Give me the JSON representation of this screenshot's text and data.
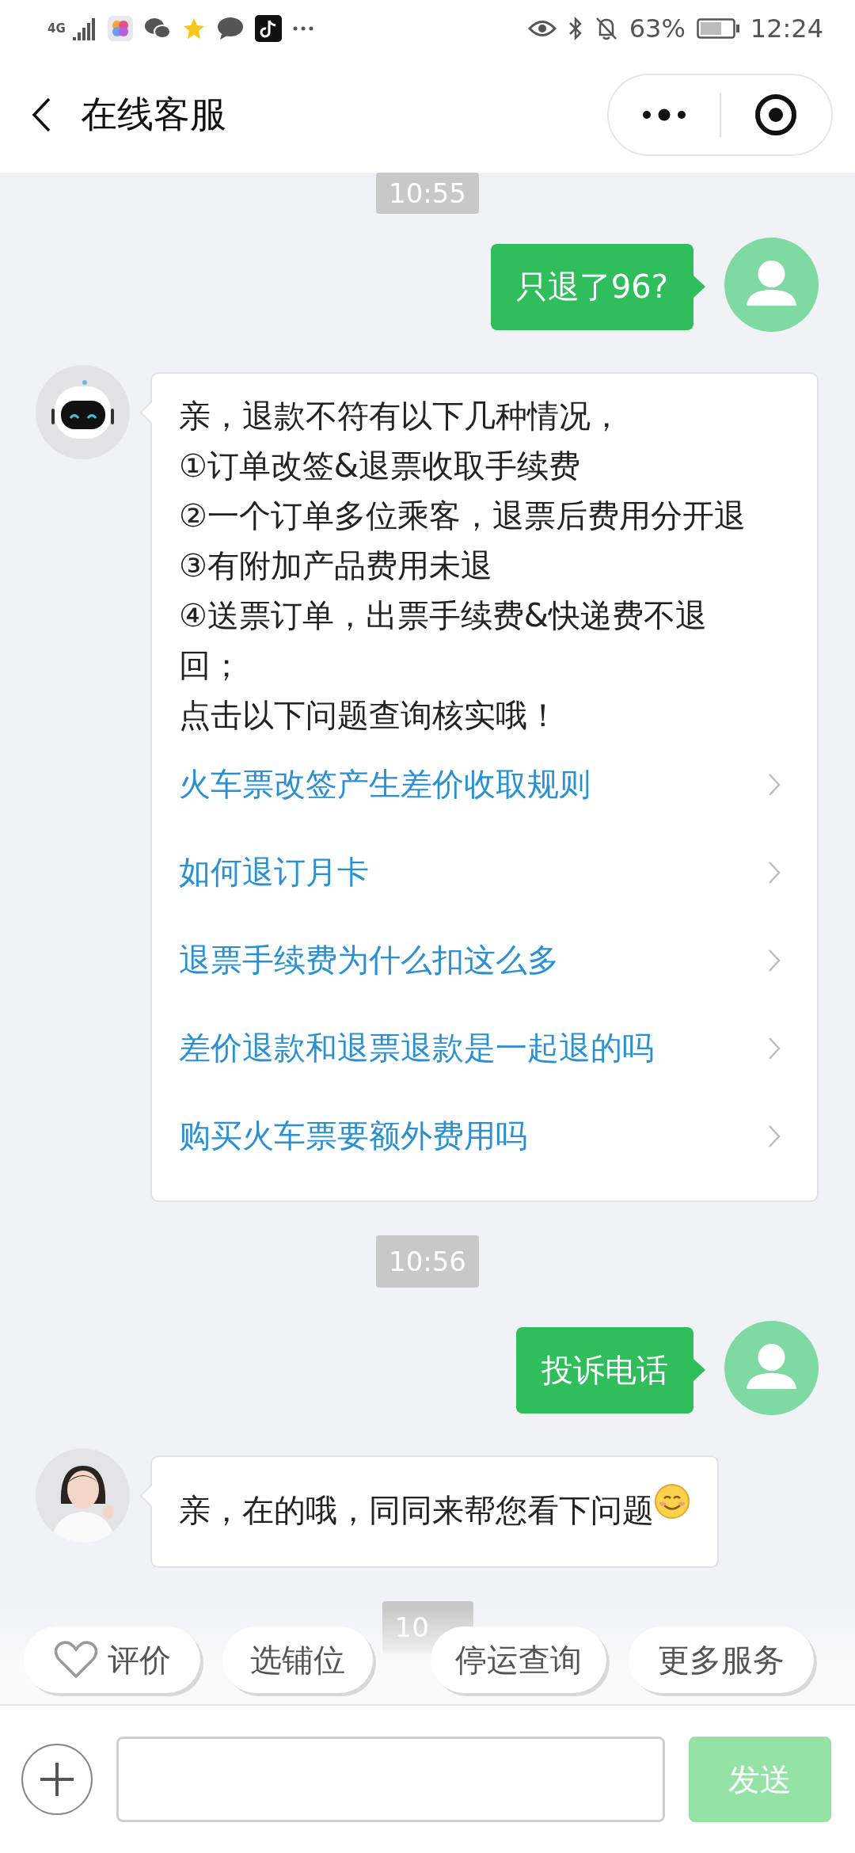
{
  "status_bar": {
    "network": "4G",
    "battery": "63%",
    "time": "12:24"
  },
  "header": {
    "title": "在线客服"
  },
  "messages": [
    {
      "kind": "time",
      "text": "10:55"
    },
    {
      "kind": "outgoing",
      "text": "只退了96?"
    },
    {
      "kind": "bot",
      "lines": [
        "亲，退款不符有以下几种情况，",
        "①订单改签&退票收取手续费",
        "②一个订单多位乘客，退票后费用分开退",
        "③有附加产品费用未退",
        "④送票订单，出票手续费&快递费不退回；",
        "点击以下问题查询核实哦！"
      ],
      "links": [
        "火车票改签产生差价收取规则",
        "如何退订月卡",
        "退票手续费为什么扣这么多",
        "差价退款和退票退款是一起退的吗",
        "购买火车票要额外费用吗"
      ]
    },
    {
      "kind": "time",
      "text": "10:56"
    },
    {
      "kind": "outgoing",
      "text": "投诉电话"
    },
    {
      "kind": "agent",
      "parts": [
        {
          "kind": "text",
          "text": "亲，在的哦，同同来帮您看下问题"
        },
        {
          "kind": "emoji"
        }
      ]
    },
    {
      "kind": "time",
      "text": "10"
    }
  ],
  "quick_replies": [
    {
      "kind": "icon",
      "label": "评价"
    },
    {
      "kind": "text",
      "label": "选铺位"
    },
    {
      "kind": "text",
      "label": "停运查询"
    },
    {
      "kind": "text",
      "label": "更多服务"
    }
  ],
  "composer": {
    "send": "发送"
  }
}
